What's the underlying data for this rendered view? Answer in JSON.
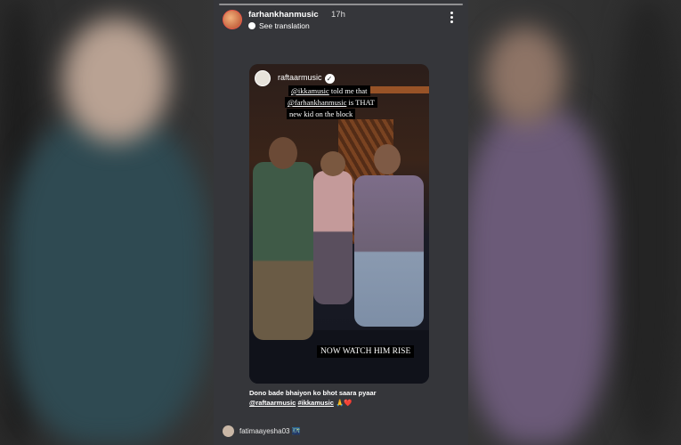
{
  "story": {
    "author": "farhankhanmusic",
    "time": "17h",
    "translate_label": "See translation",
    "repost": {
      "username": "raftaarmusic",
      "caption_line1_mention": "@ikkamusic",
      "caption_line1_rest": " told me that",
      "caption_line2_mention": "@farhankhanmusic",
      "caption_line2_rest": " is THAT",
      "caption_line3": "new kid on the block",
      "overlay_text": "NOW WATCH HIM RISE"
    },
    "caption_line1": "Dono bade bhaiyon ko bhot saara pyaar",
    "caption_tag1": "@raftaarmusic",
    "caption_tag2": "#ikkamusic",
    "caption_emoji": "🙏❤️",
    "viewer": "fatimaayesha03",
    "viewer_badge": "🌃"
  },
  "colors": {
    "story_bg": "#35363a",
    "avatar_ring": "#e8584a"
  }
}
